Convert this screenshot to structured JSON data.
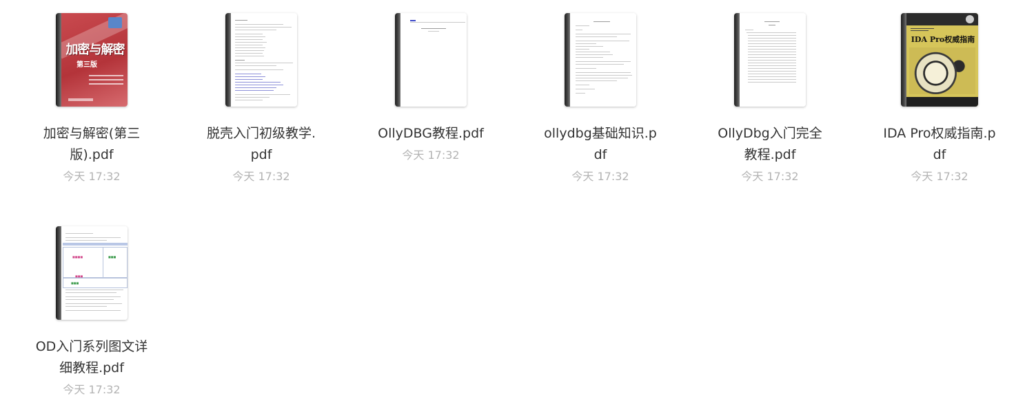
{
  "files": [
    {
      "name": "加密与解密(第三版).pdf",
      "time": "今天 17:32",
      "cover": {
        "title": "加密与解密",
        "subtitle": "第三版"
      }
    },
    {
      "name": "脱壳入门初级教学.pdf",
      "time": "今天 17:32"
    },
    {
      "name": "OllyDBG教程.pdf",
      "time": "今天 17:32"
    },
    {
      "name": "ollydbg基础知识.pdf",
      "time": "今天 17:32"
    },
    {
      "name": "OllyDbg入门完全教程.pdf",
      "time": "今天 17:32"
    },
    {
      "name": "IDA Pro权威指南.pdf",
      "time": "今天 17:32",
      "cover": {
        "title": "IDA Pro权威指南"
      }
    },
    {
      "name": "OD入门系列图文详细教程.pdf",
      "time": "今天 17:32"
    }
  ],
  "colors": {
    "filename": "#333333",
    "timestamp": "#b3b3b3",
    "red_cover": "#b4343a",
    "ida_cover": "#d6c55a"
  }
}
